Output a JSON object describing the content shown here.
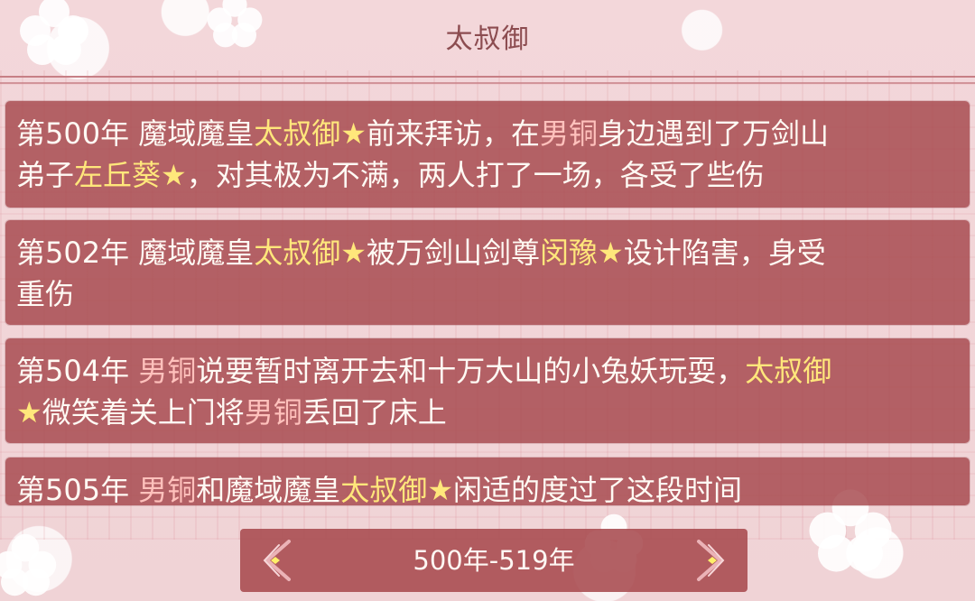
{
  "header": {
    "title": "太叔御"
  },
  "entries": [
    {
      "lines": [
        [
          {
            "text": "第500年 魔域魔皇",
            "style": "text"
          },
          {
            "text": "太叔御",
            "style": "yellow"
          },
          {
            "text": "★",
            "style": "yellow"
          },
          {
            "text": "前来拜访，在",
            "style": "text"
          },
          {
            "text": "男铜",
            "style": "pink"
          },
          {
            "text": "身边遇到了万剑山",
            "style": "text"
          }
        ],
        [
          {
            "text": "弟子",
            "style": "text"
          },
          {
            "text": "左丘葵",
            "style": "yellow"
          },
          {
            "text": "★",
            "style": "yellow"
          },
          {
            "text": "，对其极为不满，两人打了一场，各受了些伤",
            "style": "text"
          }
        ]
      ]
    },
    {
      "lines": [
        [
          {
            "text": "第502年 魔域魔皇",
            "style": "text"
          },
          {
            "text": "太叔御",
            "style": "yellow"
          },
          {
            "text": "★",
            "style": "yellow"
          },
          {
            "text": "被万剑山剑尊",
            "style": "text"
          },
          {
            "text": "闵豫",
            "style": "yellow"
          },
          {
            "text": "★",
            "style": "yellow"
          },
          {
            "text": "设计陷害，身受",
            "style": "text"
          }
        ],
        [
          {
            "text": "重伤",
            "style": "text"
          }
        ]
      ]
    },
    {
      "lines": [
        [
          {
            "text": "第504年 ",
            "style": "text"
          },
          {
            "text": "男铜",
            "style": "pink"
          },
          {
            "text": "说要暂时离开去和十万大山的小兔妖玩耍，",
            "style": "text"
          },
          {
            "text": "太叔御",
            "style": "yellow"
          }
        ],
        [
          {
            "text": "★",
            "style": "yellow"
          },
          {
            "text": "微笑着关上门将",
            "style": "text"
          },
          {
            "text": "男铜",
            "style": "pink"
          },
          {
            "text": "丢回了床上",
            "style": "text"
          }
        ]
      ]
    },
    {
      "lines": [
        [
          {
            "text": "第505年 ",
            "style": "text"
          },
          {
            "text": "男铜",
            "style": "pink"
          },
          {
            "text": "和魔域魔皇",
            "style": "text"
          },
          {
            "text": "太叔御",
            "style": "yellow"
          },
          {
            "text": "★",
            "style": "yellow"
          },
          {
            "text": "闲适的度过了这段时间",
            "style": "text"
          }
        ]
      ]
    }
  ],
  "pager": {
    "label": "500年-519年"
  },
  "icons": {
    "left": "ornate-arrow-left-icon",
    "right": "ornate-arrow-right-icon"
  },
  "colors": {
    "highlight_yellow": "#ffe77b",
    "highlight_pink": "#ffc1bc",
    "panel": "#a74a4f"
  }
}
